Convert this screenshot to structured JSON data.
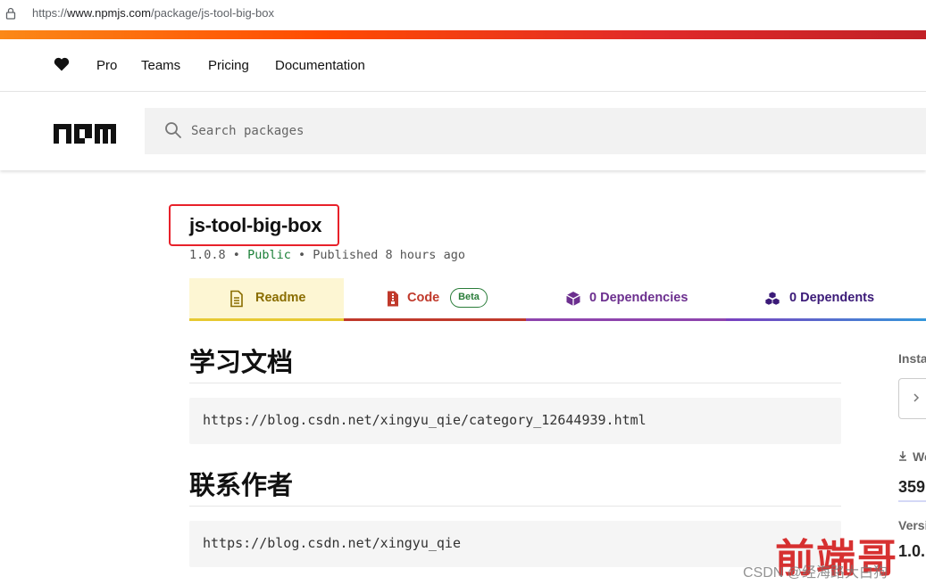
{
  "browser": {
    "url_prefix": "https://",
    "url_host": "www.npmjs.com",
    "url_path": "/package/js-tool-big-box"
  },
  "topnav": {
    "links": [
      "Pro",
      "Teams",
      "Pricing",
      "Documentation"
    ]
  },
  "search": {
    "placeholder": "Search packages"
  },
  "package": {
    "name": "js-tool-big-box",
    "version": "1.0.8",
    "visibility": "Public",
    "published": "Published 8 hours ago",
    "separator": "•"
  },
  "tabs": {
    "readme": "Readme",
    "code": "Code",
    "code_badge": "Beta",
    "dependencies": "0 Dependencies",
    "dependents": "0 Dependents"
  },
  "readme": {
    "sections": [
      {
        "heading": "学习文档",
        "code": "https://blog.csdn.net/xingyu_qie/category_12644939.html"
      },
      {
        "heading": "联系作者",
        "code": "https://blog.csdn.net/xingyu_qie"
      }
    ]
  },
  "sidebar": {
    "install_label": "Insta",
    "weekly_label": "We",
    "weekly_value": "359",
    "version_label": "Versi",
    "version_value": "1.0."
  },
  "watermark": {
    "brand": "前端哥",
    "credit": "CSDN @经海路大白狗"
  },
  "colors": {
    "brand_gradient": [
      "#fb8817",
      "#ff4b01",
      "#e12a29",
      "#c12127"
    ],
    "highlight_box": "#e8212a",
    "public_green": "#1a7f37"
  }
}
